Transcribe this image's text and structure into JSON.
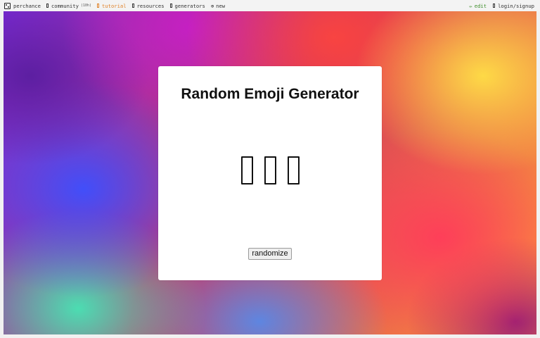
{
  "topbar": {
    "left": [
      {
        "icon": "die-icon",
        "label": "perchance"
      },
      {
        "icon": "box-icon",
        "label": "community",
        "badge": "(10h)"
      },
      {
        "icon": "box-icon",
        "label": "tutorial",
        "color": "#e0832a"
      },
      {
        "icon": "box-icon",
        "label": "resources"
      },
      {
        "icon": "box-icon",
        "label": "generators"
      },
      {
        "icon": "plus-circle-icon",
        "glyph": "⊕",
        "label": "new"
      }
    ],
    "right": [
      {
        "icon": "pencil-icon",
        "glyph": "✏",
        "label": "edit",
        "color": "#3f8e2b"
      },
      {
        "icon": "box-icon",
        "label": "login/signup"
      }
    ]
  },
  "generator": {
    "title": "Random Emoji Generator",
    "emojis": [
      "missing-glyph-icon",
      "missing-glyph-icon",
      "missing-glyph-icon"
    ],
    "button_label": "randomize"
  },
  "colors": {
    "card_background": "#ffffff",
    "accent_orange": "#e0832a",
    "accent_green": "#3f8e2b"
  }
}
